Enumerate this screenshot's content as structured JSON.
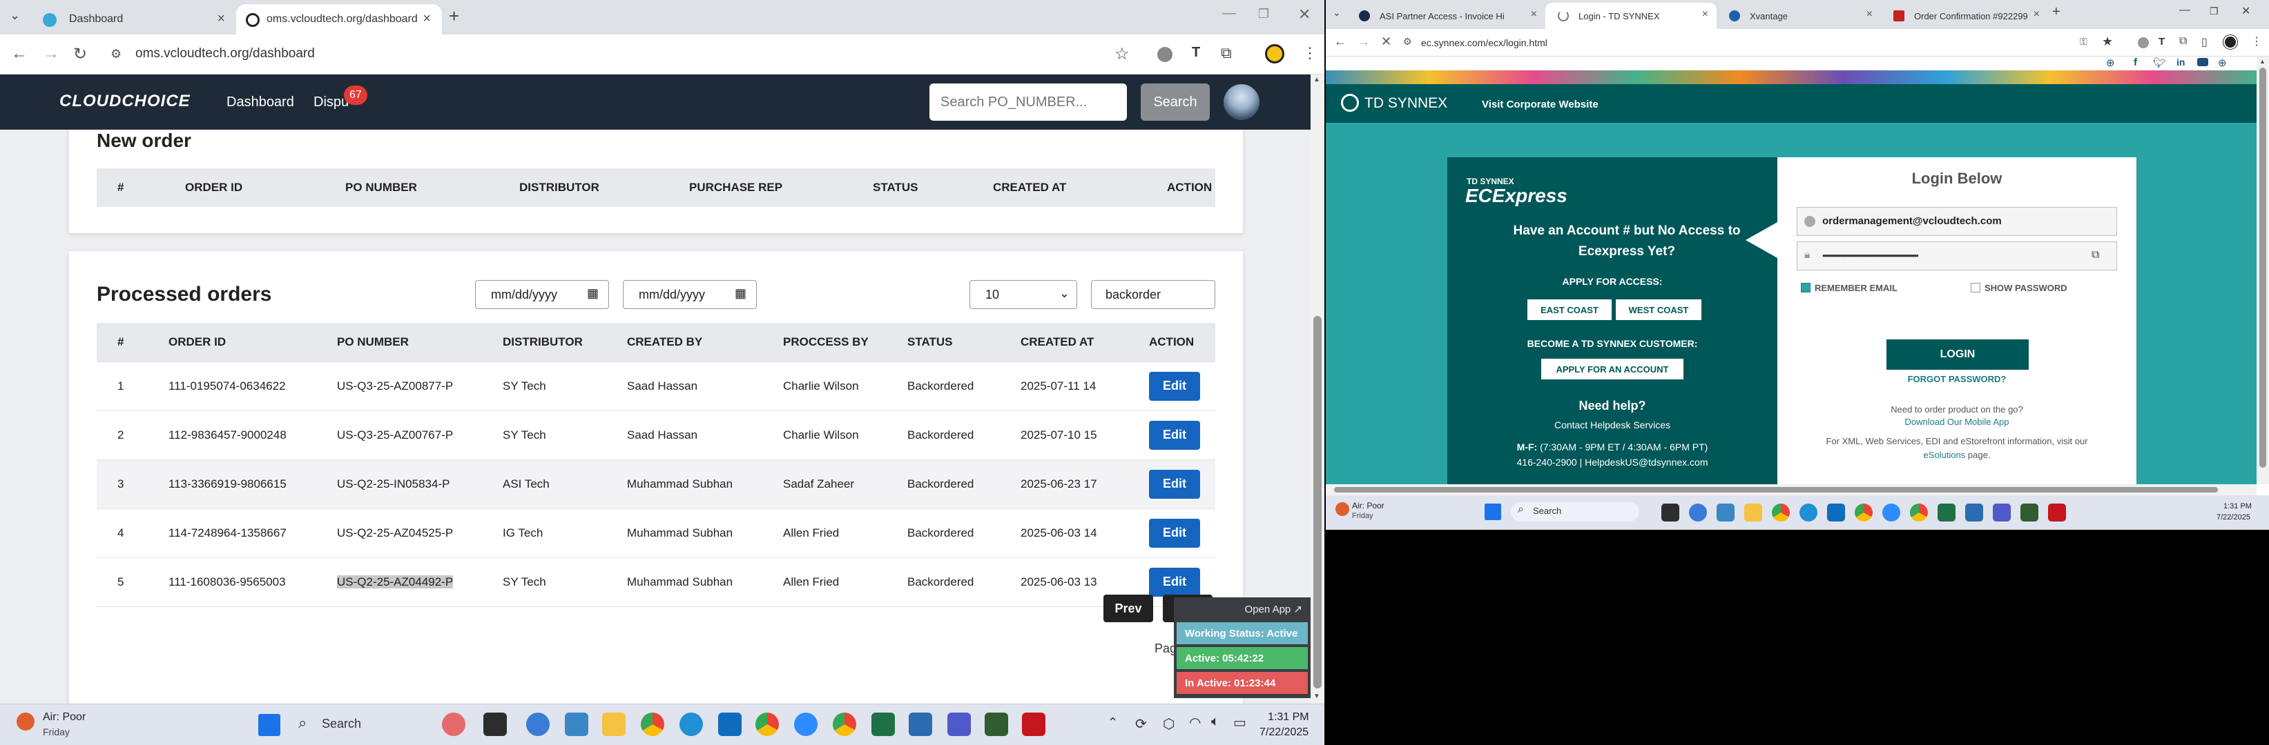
{
  "left_browser": {
    "tabs": [
      {
        "title": "Dashboard",
        "active": false
      },
      {
        "title": "oms.vcloudtech.org/dashboard",
        "active": true
      }
    ],
    "url": "oms.vcloudtech.org/dashboard",
    "app": {
      "logo": "CLOUDCHOICE",
      "nav": {
        "dashboard": "Dashboard",
        "disputes": "Dispu",
        "disputes_badge": "67"
      },
      "search_placeholder": "Search PO_NUMBER...",
      "search_button": "Search"
    },
    "new_order": {
      "title": "New order",
      "headers": [
        "#",
        "ORDER ID",
        "PO NUMBER",
        "DISTRIBUTOR",
        "PURCHASE REP",
        "STATUS",
        "CREATED AT",
        "ACTION"
      ]
    },
    "processed_orders": {
      "title": "Processed orders",
      "date_from": "mm/dd/yyyy",
      "date_to": "mm/dd/yyyy",
      "page_size": "10",
      "filter": "backorder",
      "headers": [
        "#",
        "ORDER ID",
        "PO NUMBER",
        "DISTRIBUTOR",
        "CREATED BY",
        "PROCCESS BY",
        "STATUS",
        "CREATED AT",
        "ACTION"
      ],
      "rows": [
        {
          "n": "1",
          "order_id": "111-0195074-0634622",
          "po": "US-Q3-25-AZ00877-P",
          "distributor": "SY Tech",
          "created_by": "Saad Hassan",
          "process_by": "Charlie Wilson",
          "status": "Backordered",
          "created_at": "2025-07-11 14",
          "action": "Edit"
        },
        {
          "n": "2",
          "order_id": "112-9836457-9000248",
          "po": "US-Q3-25-AZ00767-P",
          "distributor": "SY Tech",
          "created_by": "Saad Hassan",
          "process_by": "Charlie Wilson",
          "status": "Backordered",
          "created_at": "2025-07-10 15",
          "action": "Edit"
        },
        {
          "n": "3",
          "order_id": "113-3366919-9806615",
          "po": "US-Q2-25-IN05834-P",
          "distributor": "ASI Tech",
          "created_by": "Muhammad Subhan",
          "process_by": "Sadaf Zaheer",
          "status": "Backordered",
          "created_at": "2025-06-23 17",
          "action": "Edit"
        },
        {
          "n": "4",
          "order_id": "114-7248964-1358667",
          "po": "US-Q2-25-AZ04525-P",
          "distributor": "IG Tech",
          "created_by": "Muhammad Subhan",
          "process_by": "Allen Fried",
          "status": "Backordered",
          "created_at": "2025-06-03 14",
          "action": "Edit"
        },
        {
          "n": "5",
          "order_id": "111-1608036-9565003",
          "po": "US-Q2-25-AZ04492-P",
          "distributor": "SY Tech",
          "created_by": "Muhammad Subhan",
          "process_by": "Allen Fried",
          "status": "Backordered",
          "created_at": "2025-06-03 13",
          "action": "Edit"
        }
      ],
      "prev": "Prev",
      "page_label": "Pag"
    },
    "status_widget": {
      "open_app": "Open App ↗",
      "working": "Working Status: Active",
      "active": "Active: 05:42:22",
      "inactive": "In Active: 01:23:44"
    }
  },
  "right_browser": {
    "tabs": [
      {
        "title": "ASI Partner Access - Invoice Hi"
      },
      {
        "title": "Login - TD SYNNEX"
      },
      {
        "title": "Xvantage"
      },
      {
        "title": "Order Confirmation #922299"
      }
    ],
    "url": "ec.synnex.com/ecx/login.html",
    "header": {
      "brand": "TD SYNNEX",
      "visit": "Visit Corporate Website"
    },
    "promo": {
      "brand_small": "TD SYNNEX",
      "brand_big": "ECExpress",
      "question": "Have an Account # but No Access to Ecexpress Yet?",
      "apply": "APPLY FOR ACCESS:",
      "east": "EAST COAST",
      "west": "WEST COAST",
      "become": "BECOME A TD SYNNEX CUSTOMER:",
      "apply_account": "APPLY FOR AN ACCOUNT",
      "need_help": "Need help?",
      "contact": "Contact Helpdesk Services",
      "hours_prefix": "M-F:",
      "hours": "(7:30AM - 9PM ET / 4:30AM - 6PM PT)",
      "phone": "416-240-2900 | HelpdeskUS@tdsynnex.com"
    },
    "login": {
      "title": "Login Below",
      "email": "ordermanagement@vcloudtech.com",
      "password_mask": "••••••••••••••••••••••••••••••••••••••••••••••••••••••",
      "remember": "REMEMBER EMAIL",
      "show_password": "SHOW PASSWORD",
      "login_button": "LOGIN",
      "forgot": "FORGOT PASSWORD?",
      "need_order": "Need to order product on the go?",
      "download": "Download Our Mobile App",
      "xml_text": "For XML, Web Services, EDI and eStorefront information, visit our",
      "esolutions": "eSolutions",
      "page": "page."
    }
  },
  "taskbar_left": {
    "weather": "Air: Poor",
    "day": "Friday",
    "search": "Search",
    "time": "1:31 PM",
    "date": "7/22/2025"
  },
  "taskbar_right": {
    "weather": "Air: Poor",
    "day": "Friday",
    "search": "Search",
    "time": "1:31 PM",
    "date": "7/22/2025"
  }
}
